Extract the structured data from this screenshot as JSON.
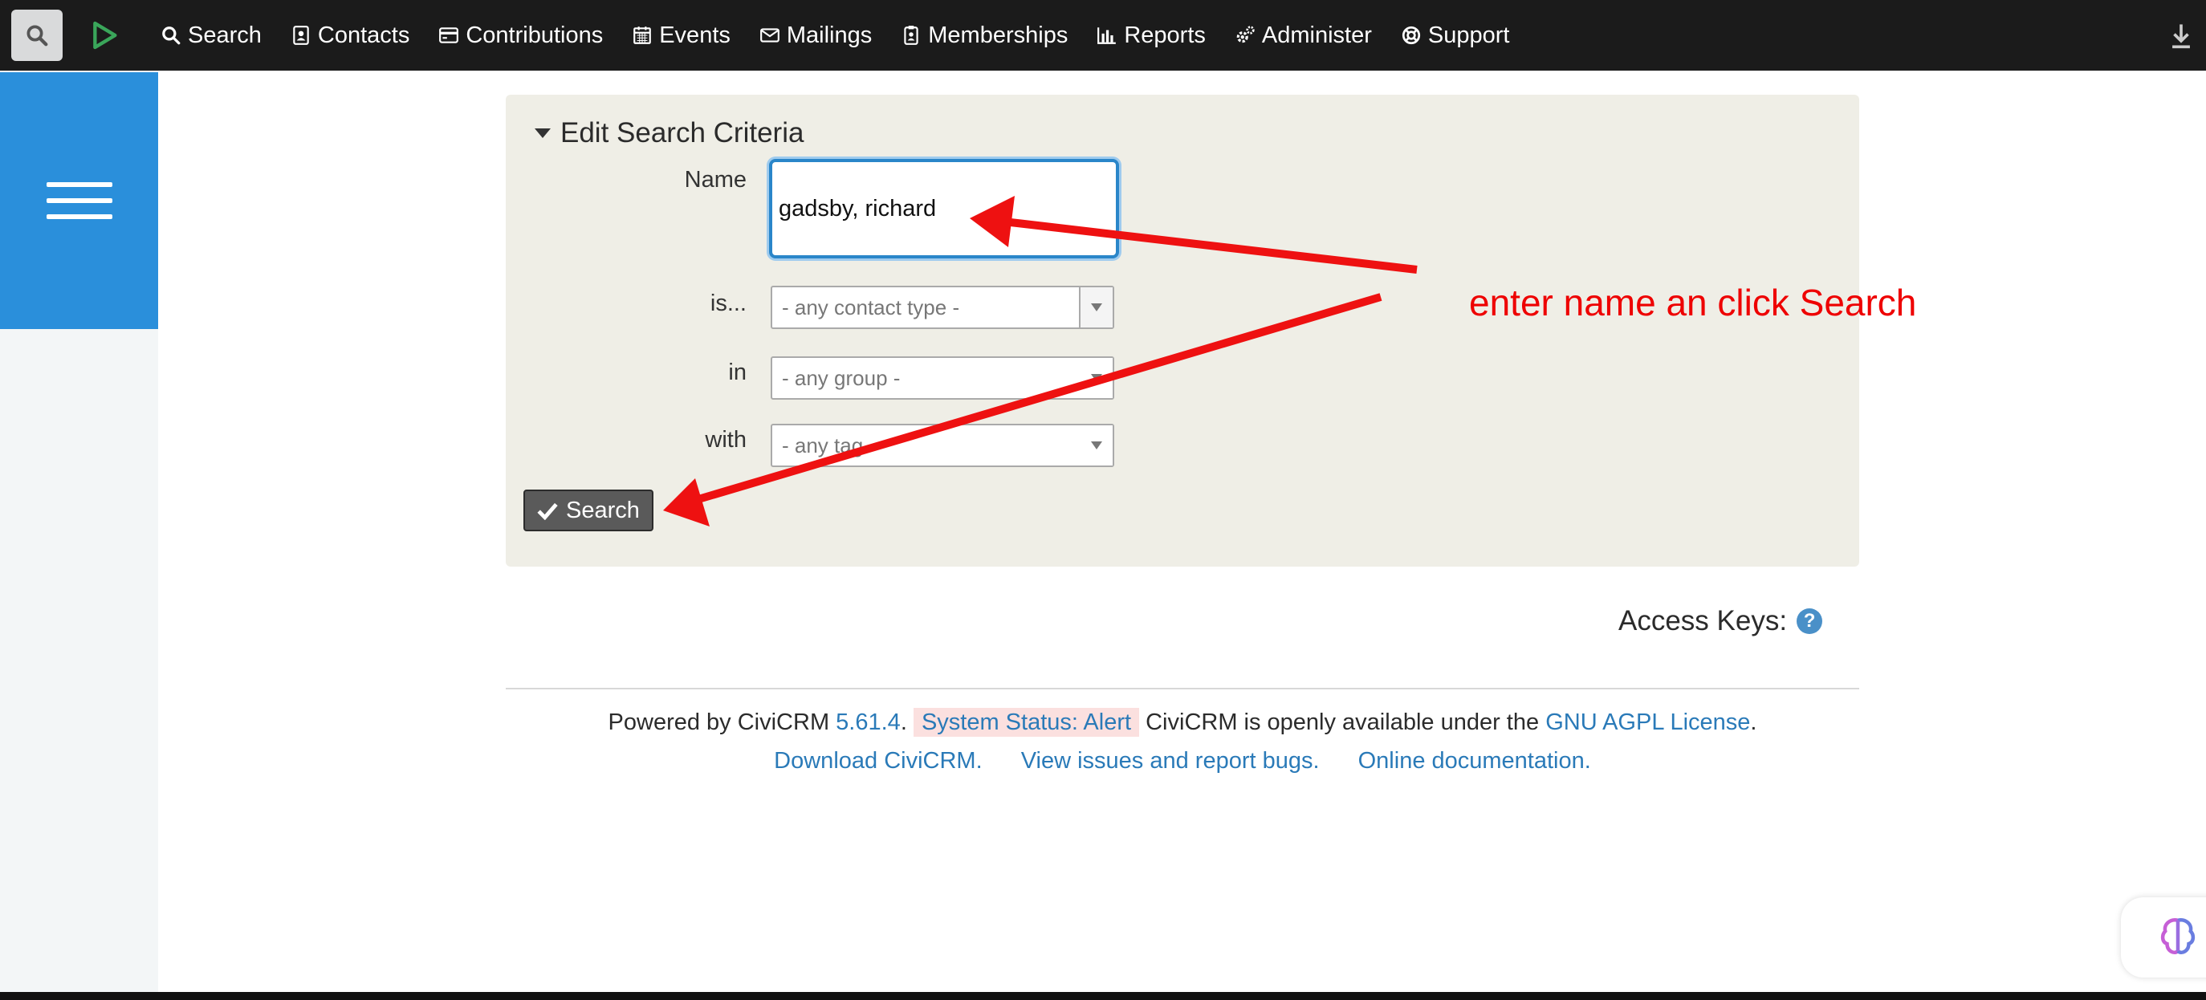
{
  "topbar": {
    "menu": [
      {
        "label": "Search",
        "icon": "search-icon"
      },
      {
        "label": "Contacts",
        "icon": "contact-card-icon"
      },
      {
        "label": "Contributions",
        "icon": "credit-card-icon"
      },
      {
        "label": "Events",
        "icon": "calendar-icon"
      },
      {
        "label": "Mailings",
        "icon": "envelope-icon"
      },
      {
        "label": "Memberships",
        "icon": "badge-icon"
      },
      {
        "label": "Reports",
        "icon": "bar-chart-icon"
      },
      {
        "label": "Administer",
        "icon": "gears-icon"
      },
      {
        "label": "Support",
        "icon": "life-ring-icon"
      }
    ]
  },
  "criteria": {
    "title": "Edit Search Criteria",
    "name_label": "Name",
    "name_value": "gadsby, richard",
    "type_label": "is...",
    "type_placeholder": "- any contact type -",
    "group_label": "in",
    "group_placeholder": "- any group -",
    "tag_label": "with",
    "tag_placeholder": "- any tag -",
    "search_button": "Search"
  },
  "access_keys": "Access Keys:",
  "footer": {
    "powered_by": "Powered by CiviCRM",
    "version": "5.61.4",
    "status": "System Status: Alert",
    "license_text": "CiviCRM is openly available under the",
    "license_link": "GNU AGPL License",
    "download": "Download CiviCRM.",
    "issues": "View issues and report bugs.",
    "docs": "Online documentation."
  },
  "annotation": "enter name an click Search",
  "colors": {
    "topbar": "#1b1b1b",
    "sidebar_toggle": "#2a8fdb",
    "annotation": "#ee0000",
    "link": "#2a7ab8"
  }
}
